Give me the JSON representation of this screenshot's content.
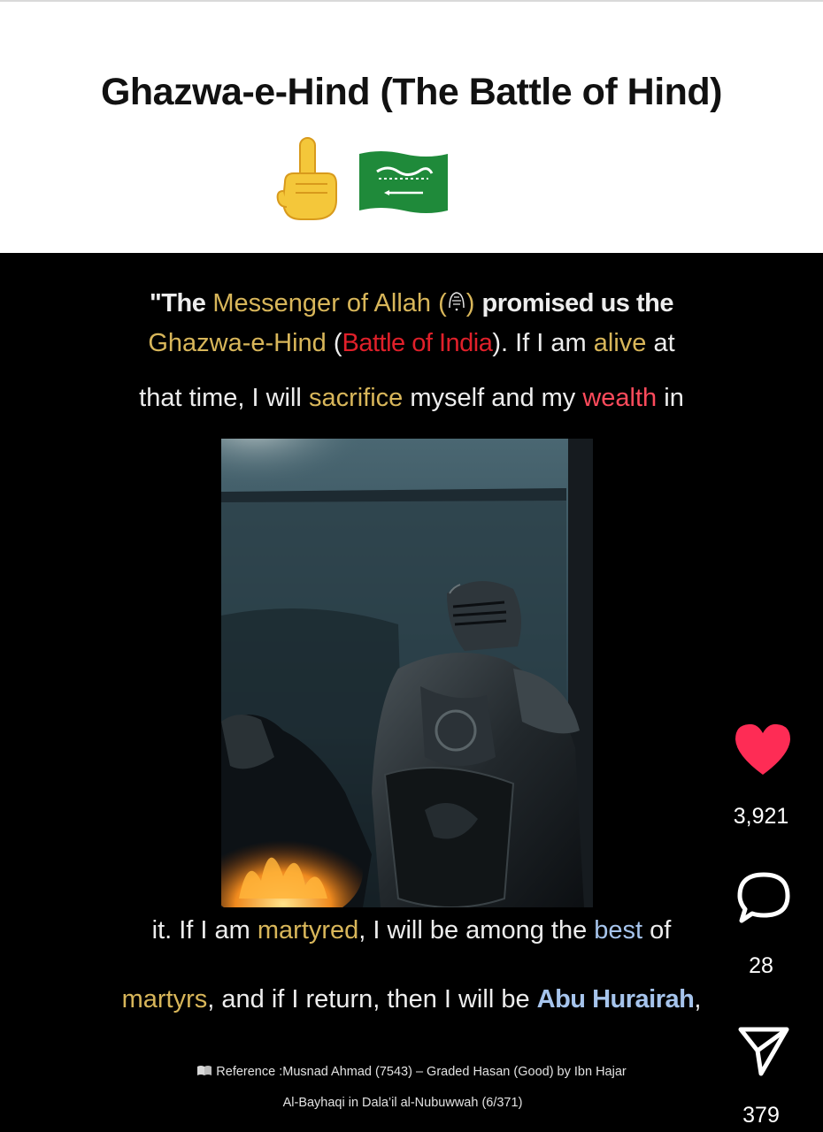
{
  "header": {
    "title": "Ghazwa-e-Hind (The Battle of Hind)",
    "emojis": [
      "pointing-up-emoji",
      "saudi-arabia-flag-emoji"
    ]
  },
  "caption": {
    "line1": {
      "quote_open": "\"The",
      "messenger": "Messenger of Allah (",
      "close_paren": ")",
      "promised": "promised us the"
    },
    "line2": {
      "ghazwa": "Ghazwa-e-Hind",
      "open": " (",
      "battle": "Battle of India",
      "rest1": "). If I am ",
      "alive": "alive",
      "rest2": " at"
    },
    "line3": {
      "part1": "that time, I will ",
      "sacrifice": "sacrifice",
      "part2": " myself and my ",
      "wealth": "wealth",
      "part3": " in"
    },
    "line4": {
      "part1": "it. If I am ",
      "martyred": "martyred",
      "part2": ", I will be among the ",
      "best": "best",
      "part3": " of"
    },
    "line5": {
      "martyrs": "martyrs",
      "part1": ", and if I return, then I will be ",
      "abu": "Abu Hurairah",
      "comma": ","
    }
  },
  "reference": {
    "line1": "Reference :Musnad Ahmad (7543) – Graded Hasan (Good) by Ibn Hajar",
    "line2": "Al-Bayhaqi in Dala’il al-Nubuwwah (6/371)"
  },
  "actions": {
    "likes": "3,921",
    "comments": "28",
    "shares": "379"
  },
  "colors": {
    "gold": "#d8b65a",
    "red": "#e0202a",
    "blue": "#a6c4ec",
    "like": "#fe2c55"
  }
}
